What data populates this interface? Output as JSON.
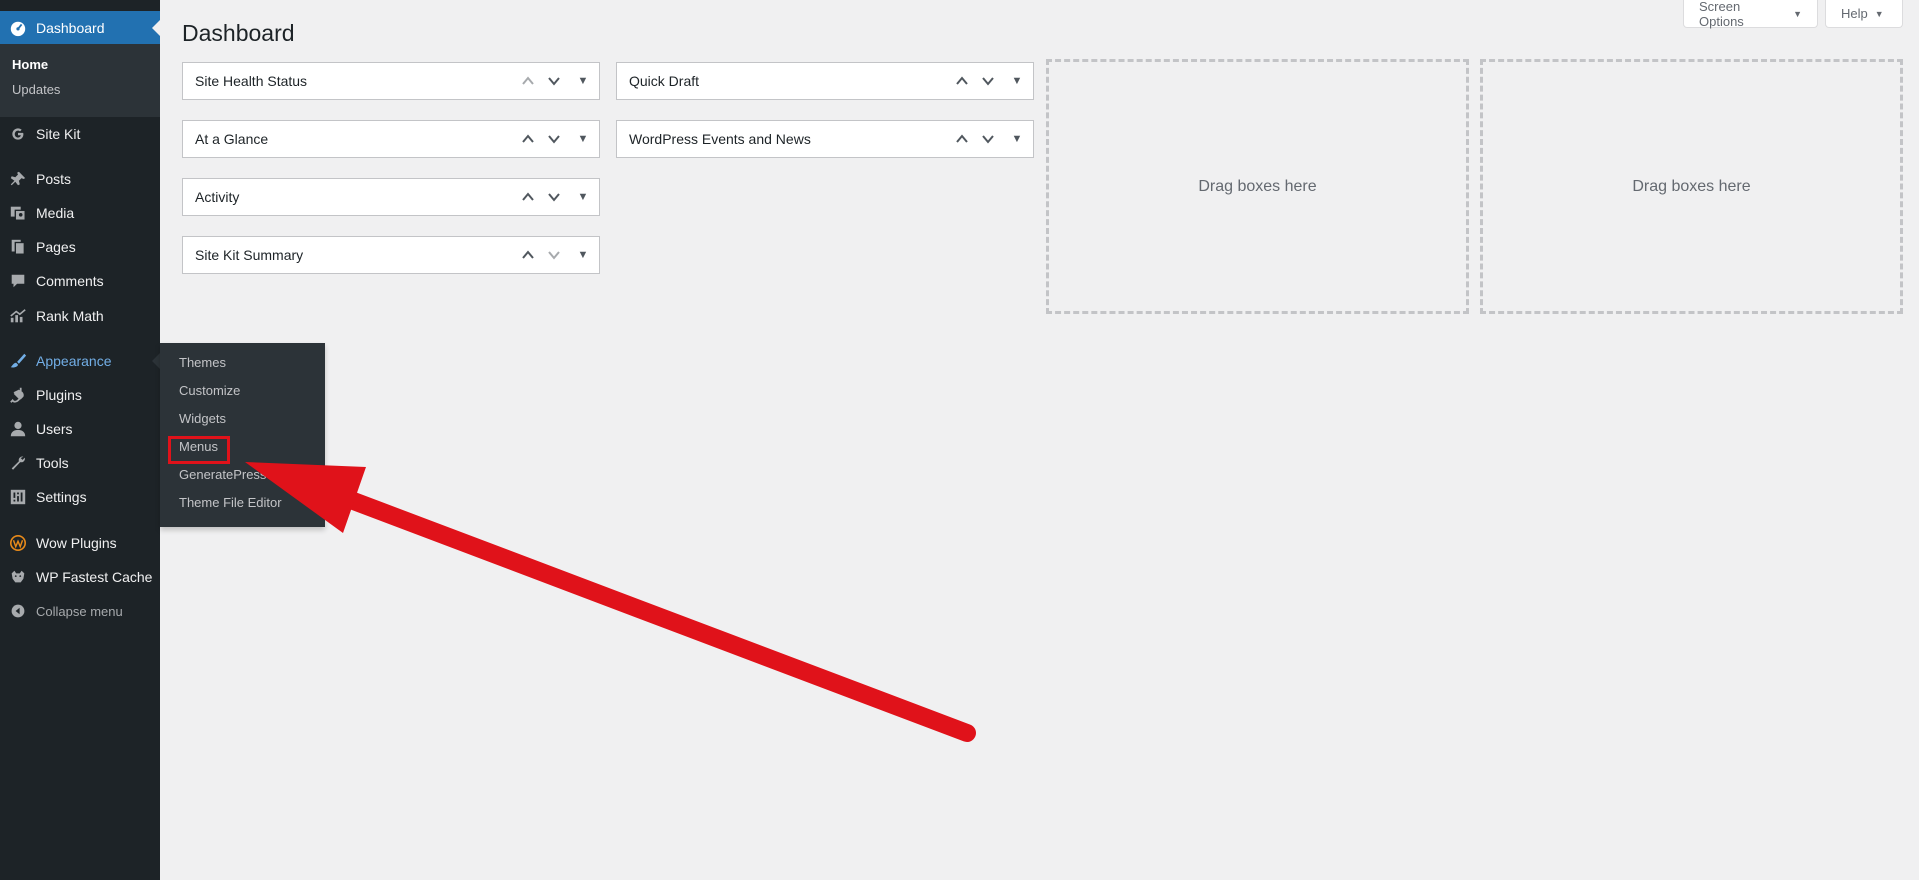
{
  "sidebar": {
    "dashboard": "Dashboard",
    "home": "Home",
    "updates": "Updates",
    "site_kit": "Site Kit",
    "posts": "Posts",
    "media": "Media",
    "pages": "Pages",
    "comments": "Comments",
    "rank_math": "Rank Math",
    "appearance": "Appearance",
    "plugins": "Plugins",
    "users": "Users",
    "tools": "Tools",
    "settings": "Settings",
    "wow_plugins": "Wow Plugins",
    "wp_fastest_cache": "WP Fastest Cache",
    "collapse": "Collapse menu"
  },
  "appearance_flyout": {
    "themes": "Themes",
    "customize": "Customize",
    "widgets": "Widgets",
    "menus": "Menus",
    "generatepress": "GeneratePress",
    "theme_file_editor": "Theme File Editor"
  },
  "header": {
    "title": "Dashboard",
    "screen_options": "Screen Options",
    "help": "Help"
  },
  "widgets": {
    "col1": [
      "Site Health Status",
      "At a Glance",
      "Activity",
      "Site Kit Summary"
    ],
    "col2": [
      "Quick Draft",
      "WordPress Events and News"
    ]
  },
  "drop_zones": [
    "Drag boxes here",
    "Drag boxes here"
  ],
  "colors": {
    "sidebar_bg": "#1d2327",
    "submenu_bg": "#2c3338",
    "accent": "#2271b1",
    "open_menu_text": "#72aee6",
    "annotation_red": "#e0121a"
  }
}
